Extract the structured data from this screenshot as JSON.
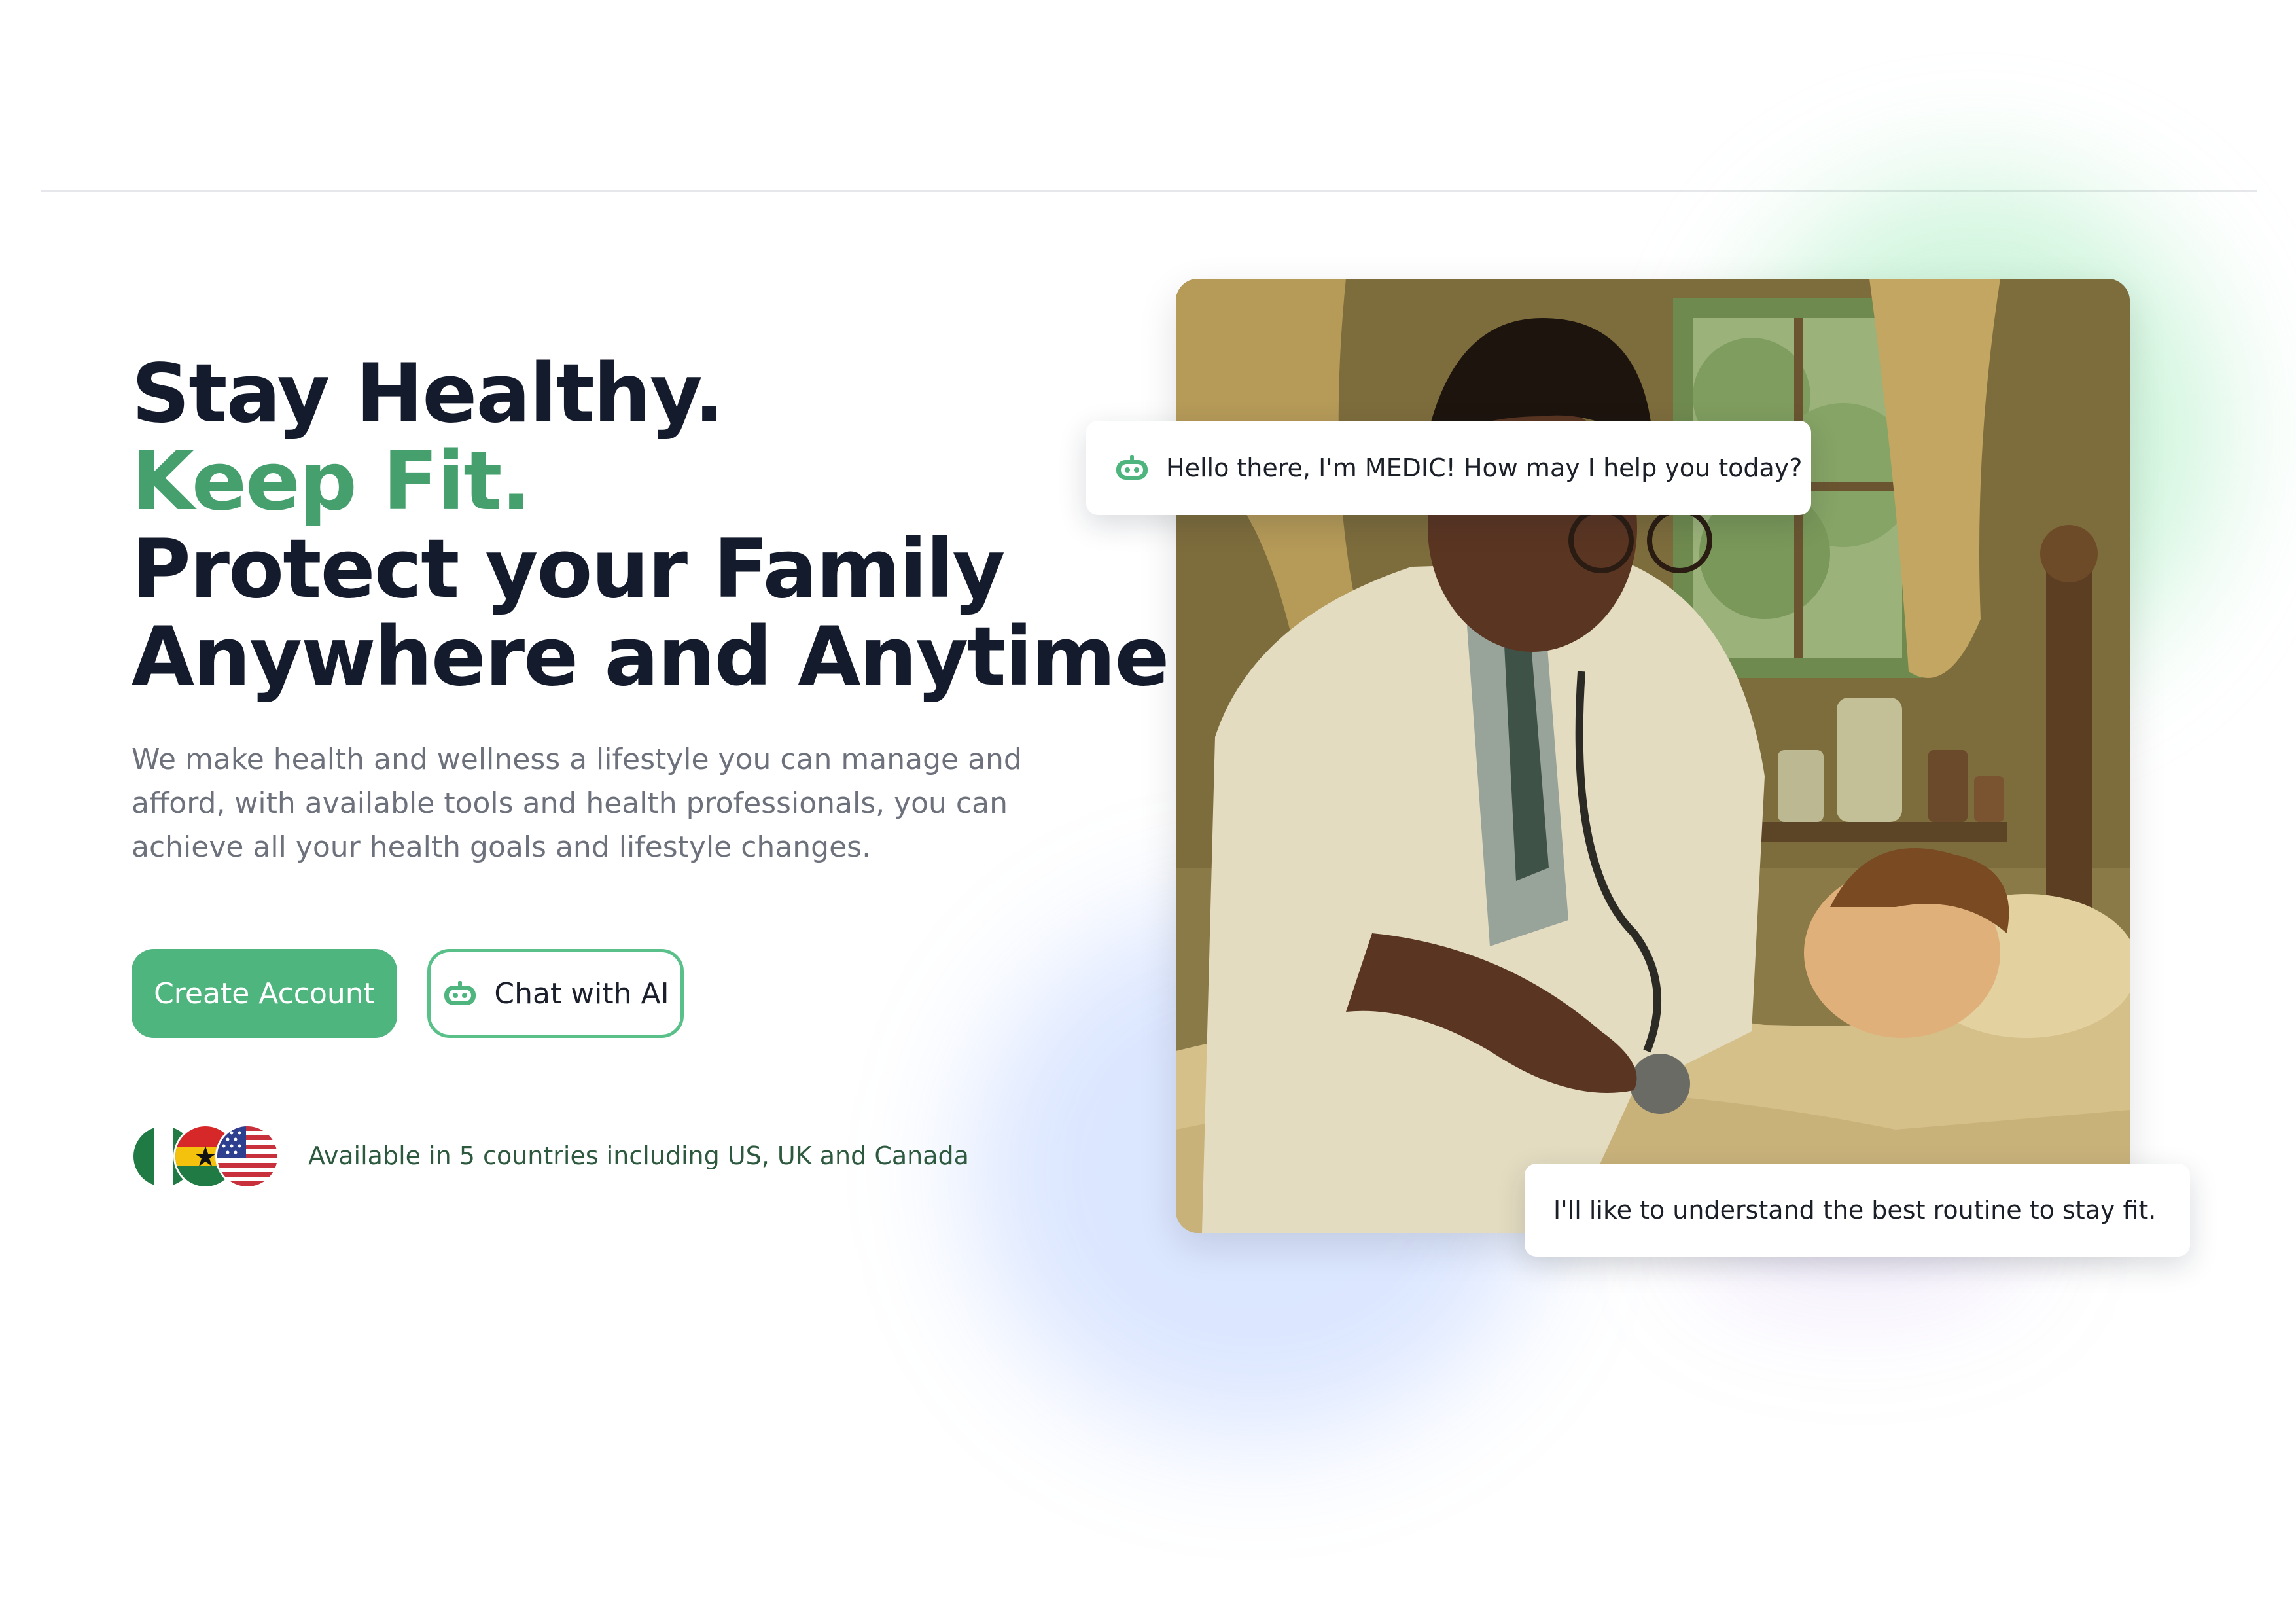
{
  "hero": {
    "line1": "Stay Healthy.",
    "line2": "Keep Fit.",
    "line3": "Protect your Family",
    "line4": "Anywhere and Anytime",
    "subtext": "We make health and wellness a lifestyle you can manage and afford, with available tools and health professionals, you can achieve all your health goals and lifestyle changes."
  },
  "actions": {
    "create_account_label": "Create Account",
    "chat_ai_label": "Chat with AI"
  },
  "availability": {
    "text": "Available in 5 countries including US, UK and Canada",
    "flags": [
      "nigeria-flag",
      "ghana-flag",
      "usa-flag"
    ]
  },
  "chat": {
    "ai_message": "Hello there, I'm MEDIC! How may I help you today?",
    "user_message": "I'll like to understand the best routine to stay fit."
  },
  "illustration": {
    "subject": "doctor examining child in bed"
  },
  "colors": {
    "accent_green": "#46a06e",
    "button_green": "#4fb57f",
    "heading_dark": "#141b2d",
    "body_gray": "#6d717c",
    "availability_green": "#2d5a3f"
  },
  "icons": {
    "bot": "bot-icon"
  }
}
